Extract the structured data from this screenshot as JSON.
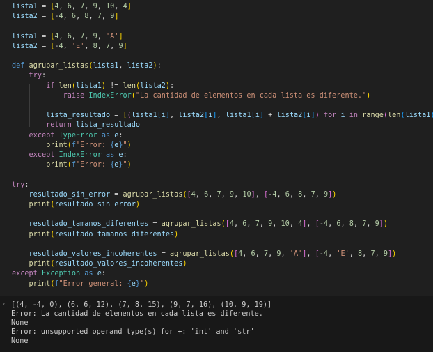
{
  "editor": {
    "lines": [
      {
        "tokens": [
          [
            "v",
            "lista1"
          ],
          [
            "p",
            " = "
          ],
          [
            "b1",
            "["
          ],
          [
            "n",
            "4"
          ],
          [
            "p",
            ", "
          ],
          [
            "n",
            "6"
          ],
          [
            "p",
            ", "
          ],
          [
            "n",
            "7"
          ],
          [
            "p",
            ", "
          ],
          [
            "n",
            "9"
          ],
          [
            "p",
            ", "
          ],
          [
            "n",
            "10"
          ],
          [
            "p",
            ", "
          ],
          [
            "n",
            "4"
          ],
          [
            "b1",
            "]"
          ]
        ]
      },
      {
        "tokens": [
          [
            "v",
            "lista2"
          ],
          [
            "p",
            " = "
          ],
          [
            "b1",
            "["
          ],
          [
            "p",
            "-"
          ],
          [
            "n",
            "4"
          ],
          [
            "p",
            ", "
          ],
          [
            "n",
            "6"
          ],
          [
            "p",
            ", "
          ],
          [
            "n",
            "8"
          ],
          [
            "p",
            ", "
          ],
          [
            "n",
            "7"
          ],
          [
            "p",
            ", "
          ],
          [
            "n",
            "9"
          ],
          [
            "b1",
            "]"
          ]
        ]
      },
      {
        "tokens": []
      },
      {
        "tokens": [
          [
            "v",
            "lista1"
          ],
          [
            "p",
            " = "
          ],
          [
            "b1",
            "["
          ],
          [
            "n",
            "4"
          ],
          [
            "p",
            ", "
          ],
          [
            "n",
            "6"
          ],
          [
            "p",
            ", "
          ],
          [
            "n",
            "7"
          ],
          [
            "p",
            ", "
          ],
          [
            "n",
            "9"
          ],
          [
            "p",
            ", "
          ],
          [
            "s",
            "'A'"
          ],
          [
            "b1",
            "]"
          ]
        ]
      },
      {
        "tokens": [
          [
            "v",
            "lista2"
          ],
          [
            "p",
            " = "
          ],
          [
            "b1",
            "["
          ],
          [
            "p",
            "-"
          ],
          [
            "n",
            "4"
          ],
          [
            "p",
            ", "
          ],
          [
            "s",
            "'E'"
          ],
          [
            "p",
            ", "
          ],
          [
            "n",
            "8"
          ],
          [
            "p",
            ", "
          ],
          [
            "n",
            "7"
          ],
          [
            "p",
            ", "
          ],
          [
            "n",
            "9"
          ],
          [
            "b1",
            "]"
          ]
        ]
      },
      {
        "tokens": []
      },
      {
        "tokens": [
          [
            "k",
            "def"
          ],
          [
            "p",
            " "
          ],
          [
            "f",
            "agrupar_listas"
          ],
          [
            "b1",
            "("
          ],
          [
            "v",
            "lista1"
          ],
          [
            "p",
            ", "
          ],
          [
            "v",
            "lista2"
          ],
          [
            "b1",
            ")"
          ],
          [
            "p",
            ":"
          ]
        ]
      },
      {
        "tokens": [
          [
            "p",
            "    "
          ],
          [
            "c",
            "try"
          ],
          [
            "p",
            ":"
          ]
        ]
      },
      {
        "tokens": [
          [
            "p",
            "        "
          ],
          [
            "c",
            "if"
          ],
          [
            "p",
            " "
          ],
          [
            "f",
            "len"
          ],
          [
            "b1",
            "("
          ],
          [
            "v",
            "lista1"
          ],
          [
            "b1",
            ")"
          ],
          [
            "p",
            " != "
          ],
          [
            "f",
            "len"
          ],
          [
            "b1",
            "("
          ],
          [
            "v",
            "lista2"
          ],
          [
            "b1",
            ")"
          ],
          [
            "p",
            ":"
          ]
        ]
      },
      {
        "tokens": [
          [
            "p",
            "            "
          ],
          [
            "c",
            "raise"
          ],
          [
            "p",
            " "
          ],
          [
            "t",
            "IndexError"
          ],
          [
            "b1",
            "("
          ],
          [
            "s",
            "\"La cantidad de elementos en cada lista es diferente.\""
          ],
          [
            "b1",
            ")"
          ]
        ]
      },
      {
        "tokens": []
      },
      {
        "tokens": [
          [
            "p",
            "        "
          ],
          [
            "v",
            "lista_resultado"
          ],
          [
            "p",
            " = "
          ],
          [
            "b1",
            "["
          ],
          [
            "b2",
            "("
          ],
          [
            "v",
            "lista1"
          ],
          [
            "b3",
            "["
          ],
          [
            "v",
            "i"
          ],
          [
            "b3",
            "]"
          ],
          [
            "p",
            ", "
          ],
          [
            "v",
            "lista2"
          ],
          [
            "b3",
            "["
          ],
          [
            "v",
            "i"
          ],
          [
            "b3",
            "]"
          ],
          [
            "p",
            ", "
          ],
          [
            "v",
            "lista1"
          ],
          [
            "b3",
            "["
          ],
          [
            "v",
            "i"
          ],
          [
            "b3",
            "]"
          ],
          [
            "p",
            " + "
          ],
          [
            "v",
            "lista2"
          ],
          [
            "b3",
            "["
          ],
          [
            "v",
            "i"
          ],
          [
            "b3",
            "]"
          ],
          [
            "b2",
            ")"
          ],
          [
            "p",
            " "
          ],
          [
            "c",
            "for"
          ],
          [
            "p",
            " "
          ],
          [
            "v",
            "i"
          ],
          [
            "p",
            " "
          ],
          [
            "c",
            "in"
          ],
          [
            "p",
            " "
          ],
          [
            "f",
            "range"
          ],
          [
            "b2",
            "("
          ],
          [
            "f",
            "len"
          ],
          [
            "b3",
            "("
          ],
          [
            "v",
            "lista1"
          ],
          [
            "b3",
            ")"
          ],
          [
            "b2",
            ")"
          ],
          [
            "b1",
            "]"
          ]
        ]
      },
      {
        "tokens": [
          [
            "p",
            "        "
          ],
          [
            "c",
            "return"
          ],
          [
            "p",
            " "
          ],
          [
            "v",
            "lista_resultado"
          ]
        ]
      },
      {
        "tokens": [
          [
            "p",
            "    "
          ],
          [
            "c",
            "except"
          ],
          [
            "p",
            " "
          ],
          [
            "t",
            "TypeError"
          ],
          [
            "p",
            " "
          ],
          [
            "k",
            "as"
          ],
          [
            "p",
            " "
          ],
          [
            "v",
            "e"
          ],
          [
            "p",
            ":"
          ]
        ]
      },
      {
        "tokens": [
          [
            "p",
            "        "
          ],
          [
            "f",
            "print"
          ],
          [
            "b1",
            "("
          ],
          [
            "k",
            "f"
          ],
          [
            "s",
            "\"Error: "
          ],
          [
            "k",
            "{"
          ],
          [
            "v",
            "e"
          ],
          [
            "k",
            "}"
          ],
          [
            "s",
            "\""
          ],
          [
            "b1",
            ")"
          ]
        ]
      },
      {
        "tokens": [
          [
            "p",
            "    "
          ],
          [
            "c",
            "except"
          ],
          [
            "p",
            " "
          ],
          [
            "t",
            "IndexError"
          ],
          [
            "p",
            " "
          ],
          [
            "k",
            "as"
          ],
          [
            "p",
            " "
          ],
          [
            "v",
            "e"
          ],
          [
            "p",
            ":"
          ]
        ]
      },
      {
        "tokens": [
          [
            "p",
            "        "
          ],
          [
            "f",
            "print"
          ],
          [
            "b1",
            "("
          ],
          [
            "k",
            "f"
          ],
          [
            "s",
            "\"Error: "
          ],
          [
            "k",
            "{"
          ],
          [
            "v",
            "e"
          ],
          [
            "k",
            "}"
          ],
          [
            "s",
            "\""
          ],
          [
            "b1",
            ")"
          ]
        ]
      },
      {
        "tokens": []
      },
      {
        "tokens": [
          [
            "c",
            "try"
          ],
          [
            "p",
            ":"
          ]
        ]
      },
      {
        "tokens": [
          [
            "p",
            "    "
          ],
          [
            "v",
            "resultado_sin_error"
          ],
          [
            "p",
            " = "
          ],
          [
            "f",
            "agrupar_listas"
          ],
          [
            "b1",
            "("
          ],
          [
            "b2",
            "["
          ],
          [
            "n",
            "4"
          ],
          [
            "p",
            ", "
          ],
          [
            "n",
            "6"
          ],
          [
            "p",
            ", "
          ],
          [
            "n",
            "7"
          ],
          [
            "p",
            ", "
          ],
          [
            "n",
            "9"
          ],
          [
            "p",
            ", "
          ],
          [
            "n",
            "10"
          ],
          [
            "b2",
            "]"
          ],
          [
            "p",
            ", "
          ],
          [
            "b2",
            "["
          ],
          [
            "p",
            "-"
          ],
          [
            "n",
            "4"
          ],
          [
            "p",
            ", "
          ],
          [
            "n",
            "6"
          ],
          [
            "p",
            ", "
          ],
          [
            "n",
            "8"
          ],
          [
            "p",
            ", "
          ],
          [
            "n",
            "7"
          ],
          [
            "p",
            ", "
          ],
          [
            "n",
            "9"
          ],
          [
            "b2",
            "]"
          ],
          [
            "b1",
            ")"
          ]
        ]
      },
      {
        "tokens": [
          [
            "p",
            "    "
          ],
          [
            "f",
            "print"
          ],
          [
            "b1",
            "("
          ],
          [
            "v",
            "resultado_sin_error"
          ],
          [
            "b1",
            ")"
          ]
        ]
      },
      {
        "tokens": []
      },
      {
        "tokens": [
          [
            "p",
            "    "
          ],
          [
            "v",
            "resultado_tamanos_diferentes"
          ],
          [
            "p",
            " = "
          ],
          [
            "f",
            "agrupar_listas"
          ],
          [
            "b1",
            "("
          ],
          [
            "b2",
            "["
          ],
          [
            "n",
            "4"
          ],
          [
            "p",
            ", "
          ],
          [
            "n",
            "6"
          ],
          [
            "p",
            ", "
          ],
          [
            "n",
            "7"
          ],
          [
            "p",
            ", "
          ],
          [
            "n",
            "9"
          ],
          [
            "p",
            ", "
          ],
          [
            "n",
            "10"
          ],
          [
            "p",
            ", "
          ],
          [
            "n",
            "4"
          ],
          [
            "b2",
            "]"
          ],
          [
            "p",
            ", "
          ],
          [
            "b2",
            "["
          ],
          [
            "p",
            "-"
          ],
          [
            "n",
            "4"
          ],
          [
            "p",
            ", "
          ],
          [
            "n",
            "6"
          ],
          [
            "p",
            ", "
          ],
          [
            "n",
            "8"
          ],
          [
            "p",
            ", "
          ],
          [
            "n",
            "7"
          ],
          [
            "p",
            ", "
          ],
          [
            "n",
            "9"
          ],
          [
            "b2",
            "]"
          ],
          [
            "b1",
            ")"
          ]
        ]
      },
      {
        "tokens": [
          [
            "p",
            "    "
          ],
          [
            "f",
            "print"
          ],
          [
            "b1",
            "("
          ],
          [
            "v",
            "resultado_tamanos_diferentes"
          ],
          [
            "b1",
            ")"
          ]
        ]
      },
      {
        "tokens": []
      },
      {
        "tokens": [
          [
            "p",
            "    "
          ],
          [
            "v",
            "resultado_valores_incoherentes"
          ],
          [
            "p",
            " = "
          ],
          [
            "f",
            "agrupar_listas"
          ],
          [
            "b1",
            "("
          ],
          [
            "b2",
            "["
          ],
          [
            "n",
            "4"
          ],
          [
            "p",
            ", "
          ],
          [
            "n",
            "6"
          ],
          [
            "p",
            ", "
          ],
          [
            "n",
            "7"
          ],
          [
            "p",
            ", "
          ],
          [
            "n",
            "9"
          ],
          [
            "p",
            ", "
          ],
          [
            "s",
            "'A'"
          ],
          [
            "b2",
            "]"
          ],
          [
            "p",
            ", "
          ],
          [
            "b2",
            "["
          ],
          [
            "p",
            "-"
          ],
          [
            "n",
            "4"
          ],
          [
            "p",
            ", "
          ],
          [
            "s",
            "'E'"
          ],
          [
            "p",
            ", "
          ],
          [
            "n",
            "8"
          ],
          [
            "p",
            ", "
          ],
          [
            "n",
            "7"
          ],
          [
            "p",
            ", "
          ],
          [
            "n",
            "9"
          ],
          [
            "b2",
            "]"
          ],
          [
            "b1",
            ")"
          ]
        ]
      },
      {
        "tokens": [
          [
            "p",
            "    "
          ],
          [
            "f",
            "print"
          ],
          [
            "b1",
            "("
          ],
          [
            "v",
            "resultado_valores_incoherentes"
          ],
          [
            "b1",
            ")"
          ]
        ]
      },
      {
        "tokens": [
          [
            "c",
            "except"
          ],
          [
            "p",
            " "
          ],
          [
            "t",
            "Exception"
          ],
          [
            "p",
            " "
          ],
          [
            "k",
            "as"
          ],
          [
            "p",
            " "
          ],
          [
            "v",
            "e"
          ],
          [
            "p",
            ":"
          ]
        ]
      },
      {
        "tokens": [
          [
            "p",
            "    "
          ],
          [
            "f",
            "print"
          ],
          [
            "b1",
            "("
          ],
          [
            "k",
            "f"
          ],
          [
            "s",
            "\"Error general: "
          ],
          [
            "k",
            "{"
          ],
          [
            "v",
            "e"
          ],
          [
            "k",
            "}"
          ],
          [
            "s",
            "\""
          ],
          [
            "b1",
            ")"
          ]
        ]
      }
    ]
  },
  "output": {
    "lines": [
      "[(4, -4, 0), (6, 6, 12), (7, 8, 15), (9, 7, 16), (10, 9, 19)]",
      "Error: La cantidad de elementos en cada lista es diferente.",
      "None",
      "Error: unsupported operand type(s) for +: 'int' and 'str'",
      "None"
    ],
    "gutter_icon": "chevron-right-icon"
  }
}
